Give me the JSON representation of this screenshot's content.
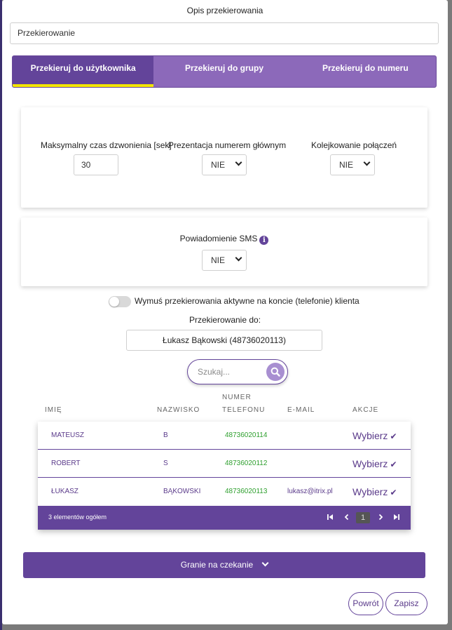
{
  "description": {
    "label": "Opis przekierowania",
    "value": "Przekierowanie"
  },
  "tabs": [
    {
      "label": "Przekieruj do użytkownika",
      "active": true
    },
    {
      "label": "Przekieruj do grupy",
      "active": false
    },
    {
      "label": "Przekieruj do numeru",
      "active": false
    }
  ],
  "settings": {
    "max_ring_label": "Maksymalny czas dzwonienia [sek]",
    "max_ring_value": "30",
    "main_number_label": "Prezentacja numerem głównym",
    "main_number_value": "NIE",
    "queue_label": "Kolejkowanie połączeń",
    "queue_value": "NIE",
    "sms_label": "Powiadomienie SMS",
    "sms_value": "NIE"
  },
  "force_toggle": {
    "label": "Wymuś przekierowania aktywne na koncie (telefonie) klienta",
    "on": false
  },
  "target": {
    "label": "Przekierowanie do:",
    "value": "Łukasz Bąkowski (48736020113)"
  },
  "search": {
    "placeholder": "Szukaj..."
  },
  "table": {
    "headers": {
      "name": "IMIĘ",
      "surname": "NAZWISKO",
      "phone_line1": "NUMER",
      "phone_line2": "TELEFONU",
      "email": "E-MAIL",
      "actions": "AKCJE"
    },
    "rows": [
      {
        "name": "MATEUSZ",
        "surname": "B",
        "phone": "48736020114",
        "email": "",
        "action": "Wybierz"
      },
      {
        "name": "ROBERT",
        "surname": "S",
        "phone": "48736020112",
        "email": "",
        "action": "Wybierz"
      },
      {
        "name": "ŁUKASZ",
        "surname": "BĄKOWSKI",
        "phone": "48736020113",
        "email": "lukasz@itrix.pl",
        "action": "Wybierz"
      }
    ],
    "footer": {
      "count": "3 elementów ogółem",
      "current_page": "1"
    }
  },
  "hold_music": {
    "label": "Granie na czekanie"
  },
  "buttons": {
    "back": "Powrót",
    "save": "Zapisz"
  },
  "colors": {
    "primary": "#63449a",
    "tab_bar": "#8c69ba",
    "active_underline": "#f3e600",
    "phone_text": "#2e9f2e"
  }
}
